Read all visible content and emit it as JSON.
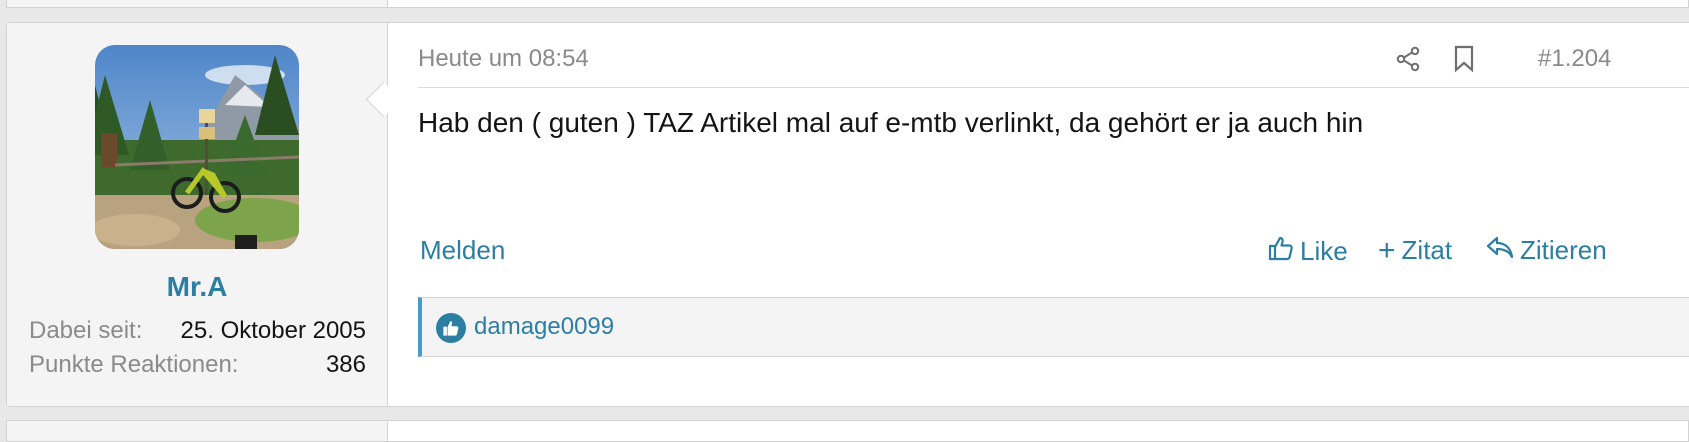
{
  "post": {
    "date": "Heute um 08:54",
    "number": "#1.204",
    "message": "Hab den ( guten ) TAZ Artikel mal auf e-mtb verlinkt, da gehört er ja auch hin",
    "actions": {
      "report": "Melden",
      "like": "Like",
      "quote": "Zitat",
      "reply": "Zitieren"
    },
    "reactions": {
      "icon": "thumbs-up-icon",
      "users": "damage0099"
    }
  },
  "user": {
    "name": "Mr.A",
    "joined_label": "Dabei seit:",
    "joined_value": "25. Oktober 2005",
    "reactions_label": "Punkte Reaktionen:",
    "reactions_value": "386"
  },
  "colors": {
    "link": "#2d7ea3",
    "muted": "#8a8a8a",
    "text": "#141414",
    "panel": "#f4f4f4",
    "accent_bar": "#4a9bc9"
  }
}
